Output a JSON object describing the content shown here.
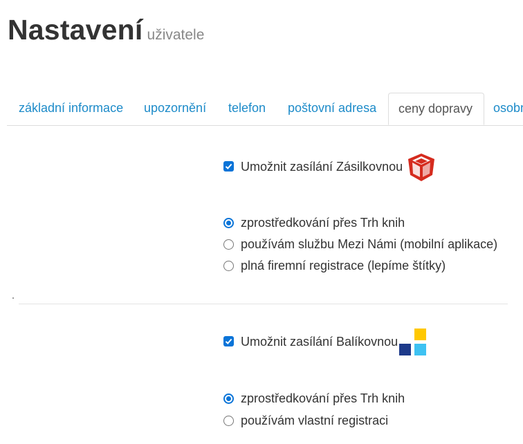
{
  "header": {
    "title": "Nastavení",
    "subtitle": "uživatele"
  },
  "tabs": [
    {
      "label": "základní informace",
      "active": false
    },
    {
      "label": "upozornění",
      "active": false
    },
    {
      "label": "telefon",
      "active": false
    },
    {
      "label": "poštovní adresa",
      "active": false
    },
    {
      "label": "ceny dopravy",
      "active": true
    },
    {
      "label": "osobn",
      "active": false
    }
  ],
  "zasilkovna": {
    "enable_label": "Umožnit zasílání Zásilkovnou",
    "enabled": true,
    "options": [
      {
        "label": "zprostředkování přes Trh knih",
        "selected": true
      },
      {
        "label": "používám službu Mezi Námi (mobilní aplikace)",
        "selected": false
      },
      {
        "label": "plná firemní registrace (lepíme štítky)",
        "selected": false
      }
    ]
  },
  "balikovna": {
    "enable_label": "Umožnit zasílání Balíkovnou",
    "enabled": true,
    "options": [
      {
        "label": "zprostředkování přes Trh knih",
        "selected": true
      },
      {
        "label": "používám vlastní registraci",
        "selected": false
      }
    ]
  },
  "colors": {
    "link": "#1d8bc9",
    "accent": "#0a74d8",
    "zasilkovna_red": "#d52b1e",
    "balikovna_navy": "#1d3a8a",
    "balikovna_yellow": "#ffc800",
    "balikovna_sky": "#3ec2f2"
  },
  "icons": [
    "zasilkovna-logo-icon",
    "balikovna-logo-icon",
    "checkbox-check-icon"
  ]
}
